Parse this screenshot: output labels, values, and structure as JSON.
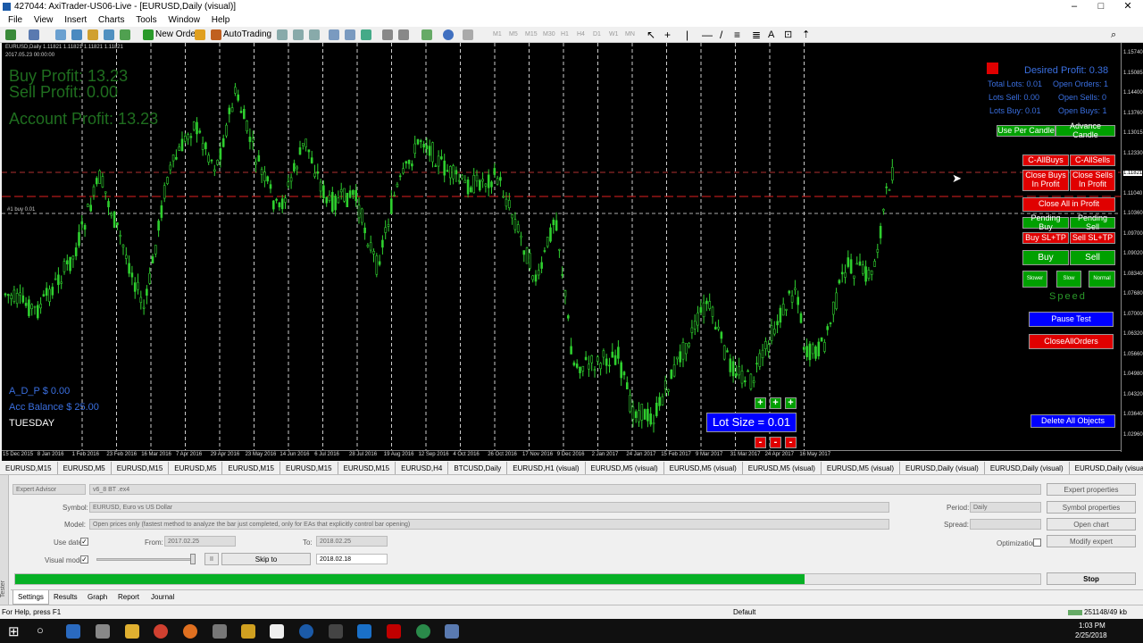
{
  "window": {
    "title": "427044: AxiTrader-US06-Live - [EURUSD,Daily (visual)]",
    "minimize": "–",
    "maximize": "□",
    "close": "✕"
  },
  "menu": [
    "File",
    "View",
    "Insert",
    "Charts",
    "Tools",
    "Window",
    "Help"
  ],
  "toolbar": {
    "new_order": "New Order",
    "autotrading": "AutoTrading",
    "timeframes": [
      "M1",
      "M5",
      "M15",
      "M30",
      "H1",
      "H4",
      "D1",
      "W1",
      "MN"
    ]
  },
  "chart": {
    "header": "EURUSD,Daily 1.11821 1.11821 1.11821 1.11821",
    "subheader": "2017.05.23 00:00:00",
    "buy_profit": "Buy Profit: 13.23",
    "sell_profit": "Sell Profit: 0.00",
    "account_profit": "Account Profit: 13.23",
    "adp": "A_D_P $  0.00",
    "acc_balance": "Acc Balance $  25.00",
    "day": "TUESDAY",
    "trade_label": "#1 buy 0.01",
    "desired_profit": "Desired Profit: 0.38",
    "total_lots": "Total Lots: 0.01",
    "open_orders": "Open Orders: 1",
    "lots_sell": "Lots Sell: 0.00",
    "open_sells": "Open Sells: 0",
    "lots_buy": "Lots Buy: 0.01",
    "open_buys": "Open Buys: 1",
    "lot_size": "Lot Size = 0.01",
    "speed": "Speed",
    "plus": "+",
    "minus": "-",
    "y_labels": [
      "1.15740",
      "1.15085",
      "1.14400",
      "1.13760",
      "1.13015",
      "1.12330",
      "1.11821",
      "1.11040",
      "1.10360",
      "1.09700",
      "1.09020",
      "1.08340",
      "1.07680",
      "1.07000",
      "1.06320",
      "1.05660",
      "1.04980",
      "1.04320",
      "1.03640",
      "1.02960"
    ],
    "x_labels": [
      "15 Dec 2015",
      "8 Jan 2016",
      "1 Feb 2016",
      "23 Feb 2016",
      "16 Mar 2016",
      "7 Apr 2016",
      "29 Apr 2016",
      "23 May 2016",
      "14 Jun 2016",
      "6 Jul 2016",
      "28 Jul 2016",
      "19 Aug 2016",
      "12 Sep 2016",
      "4 Oct 2016",
      "26 Oct 2016",
      "17 Nov 2016",
      "9 Dec 2016",
      "2 Jan 2017",
      "24 Jan 2017",
      "15 Feb 2017",
      "9 Mar 2017",
      "31 Mar 2017",
      "24 Apr 2017",
      "16 May 2017"
    ]
  },
  "buttons": {
    "use_per_candle": "Use Per Candle",
    "advance_candle": "Advance Candle",
    "c_allbuys": "C-AllBuys",
    "c_allsells": "C-AllSells",
    "close_buys_profit": "Close Buys In Profit",
    "close_sells_profit": "Close Sells In Profit",
    "close_all_profit": "Close All in Profit",
    "pending_buy": "Pending Buy",
    "pending_sell": "Pending Sell",
    "buy_sltp": "Buy SL+TP",
    "sell_sltp": "Sell SL+TP",
    "buy": "Buy",
    "sell": "Sell",
    "slower": "Slower",
    "slow": "Slow",
    "normal": "Normal",
    "pause_test": "Pause Test",
    "close_all_orders": "CloseAllOrders",
    "delete_all": "Delete All Objects"
  },
  "tabs": [
    "EURUSD,M15",
    "EURUSD,M5",
    "EURUSD,M15",
    "EURUSD,M5",
    "EURUSD,M15",
    "EURUSD,M15",
    "EURUSD,M15",
    "EURUSD,H4",
    "BTCUSD,Daily",
    "EURUSD,H1 (visual)",
    "EURUSD,M5 (visual)",
    "EURUSD,M5 (visual)",
    "EURUSD,M5 (visual)",
    "EURUSD,M5 (visual)",
    "EURUSD,Daily (visual)",
    "EURUSD,Daily (visual)",
    "EURUSD,Daily (visual)",
    "EU"
  ],
  "tester": {
    "mode": "Expert Advisor",
    "ea": "v6_8 BT .ex4",
    "symbol_label": "Symbol:",
    "symbol": "EURUSD, Euro vs US Dollar",
    "model_label": "Model:",
    "model": "Open prices only (fastest method to analyze the bar just completed, only for EAs that explicitly control bar opening)",
    "use_date": "Use date",
    "from_label": "From:",
    "from": "2017.02.25",
    "to_label": "To:",
    "to": "2018.02.25",
    "visual_mode": "Visual mode",
    "skip_to": "Skip to",
    "skip_date": "2018.02.18",
    "period_label": "Period:",
    "period": "Daily",
    "spread_label": "Spread:",
    "optimization": "Optimization",
    "expert_properties": "Expert properties",
    "symbol_properties": "Symbol properties",
    "open_chart": "Open chart",
    "modify_expert": "Modify expert",
    "stop": "Stop",
    "progress": 0.77,
    "tabs": [
      "Settings",
      "Results",
      "Graph",
      "Report",
      "Journal"
    ],
    "side_label": "Tester",
    "pause_glyph": "II"
  },
  "status": {
    "help": "For Help, press F1",
    "profile": "Default",
    "traffic": "251148/49 kb"
  },
  "taskbar": {
    "time": "1:03 PM",
    "date": "2/25/2018"
  }
}
